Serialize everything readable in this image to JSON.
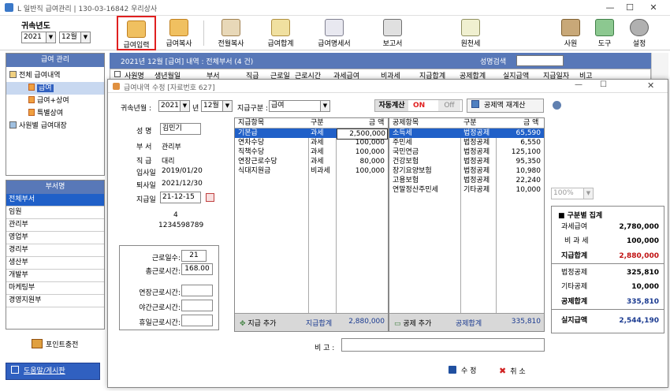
{
  "window": {
    "title": "L 일반직 급여관리 | 130-03-16842 우리상사"
  },
  "toolbar": {
    "year_label": "귀속년도",
    "year_value": "2021",
    "month_value": "12월",
    "buttons": [
      "급여입력",
      "급여복사",
      "전월복사",
      "급여합계",
      "급여명세서",
      "보고서",
      "원천세",
      "사원",
      "도구",
      "설정"
    ]
  },
  "left": {
    "panel_title": "급여 관리",
    "tree": [
      "전체 급여내역",
      "급여",
      "급여+상여",
      "특별상여",
      "사원별 급여대장"
    ],
    "dept_title": "부서명",
    "depts": [
      "전체부서",
      "임원",
      "관리부",
      "영업부",
      "경리부",
      "생산부",
      "개발부",
      "마케팅부",
      "경영지원부"
    ],
    "point_label": "포인트충전",
    "help_label": "도움말/게시판"
  },
  "main": {
    "info": "2021년 12월 [급여] 내역 : 전체부서 (4 건)",
    "search_label": "성명검색",
    "columns": [
      "사원명",
      "생년월일",
      "부서",
      "직급",
      "근로일",
      "근로시간",
      "과세급여",
      "비과세",
      "지급합계",
      "공제합계",
      "실지급액",
      "지급일자",
      "비고"
    ]
  },
  "dialog": {
    "title": "급여내역 수정 [자료번호 627]",
    "period_label": "귀속년월 :",
    "year": "2021",
    "year_unit": "년",
    "month": "12월",
    "pay_type_label": "지급구분 :",
    "pay_type": "급여",
    "auto_calc_label": "자동계산",
    "auto_on": "ON",
    "auto_off": "Off",
    "recalc_label": "공제액 재계산",
    "emp": {
      "name_label": "성 명",
      "name": "김민기",
      "dept_label": "부 서",
      "dept": "관리부",
      "rank_label": "직 급",
      "rank": "대리",
      "join_label": "입사일",
      "join": "2019/01/20",
      "leave_label": "퇴사일",
      "leave": "2021/12/30",
      "paydate_label": "지급일",
      "paydate": "21-12-15",
      "code": "4",
      "account": "1234598789"
    },
    "work": {
      "days_label": "근로일수:",
      "days": "21",
      "hours_label": "총근로시간:",
      "hours": "168.00",
      "ot_label": "연장근로시간:",
      "night_label": "야간근로시간:",
      "holiday_label": "휴일근로시간:"
    },
    "pay_table": {
      "headers": [
        "지급항목",
        "구분",
        "금 액"
      ],
      "rows": [
        [
          "기본급",
          "과세",
          "2,500,000"
        ],
        [
          "연차수당",
          "과세",
          "100,000"
        ],
        [
          "직책수당",
          "과세",
          "100,000"
        ],
        [
          "연장근로수당",
          "과세",
          "80,000"
        ],
        [
          "식대지원금",
          "비과세",
          "100,000"
        ]
      ],
      "add_label": "지급 추가",
      "total_label": "지급합계",
      "total": "2,880,000"
    },
    "ded_table": {
      "headers": [
        "공제항목",
        "구분",
        "금 액"
      ],
      "rows": [
        [
          "소득세",
          "법정공제",
          "65,590"
        ],
        [
          "주민세",
          "법정공제",
          "6,550"
        ],
        [
          "국민연금",
          "법정공제",
          "125,100"
        ],
        [
          "건강보험",
          "법정공제",
          "95,350"
        ],
        [
          "장기요양보험",
          "법정공제",
          "10,980"
        ],
        [
          "고용보험",
          "법정공제",
          "22,240"
        ],
        [
          "연말정산주민세",
          "기타공제",
          "10,000"
        ]
      ],
      "add_label": "공제 추가",
      "total_label": "공제합계",
      "total": "335,810"
    },
    "zoom": "100%",
    "summary": {
      "title": "■ 구분별 집계",
      "rows": [
        {
          "label": "과세급여",
          "value": "2,780,000"
        },
        {
          "label": "비 과 세",
          "value": "100,000"
        },
        {
          "label": "지급합계",
          "value": "2,880,000"
        },
        {
          "label": "법정공제",
          "value": "325,810"
        },
        {
          "label": "기타공제",
          "value": "10,000"
        },
        {
          "label": "공제합계",
          "value": "335,810"
        },
        {
          "label": "실지급액",
          "value": "2,544,190"
        }
      ]
    },
    "memo_label": "비 고 :",
    "save_label": "수 정",
    "cancel_label": "취 소"
  }
}
